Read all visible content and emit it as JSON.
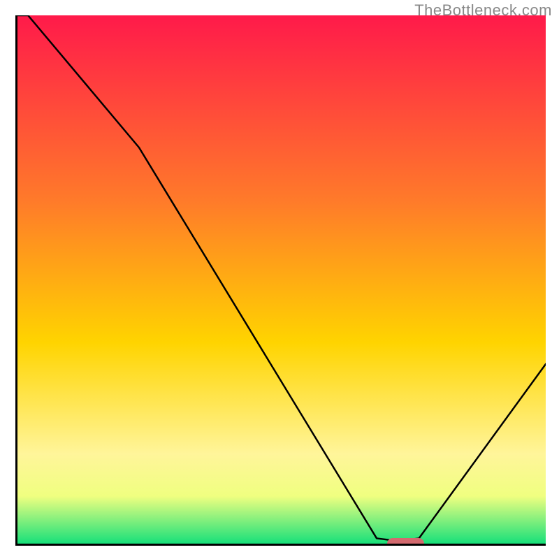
{
  "watermark": "TheBottleneck.com",
  "colors": {
    "top": "#ff1a4a",
    "mid1": "#ff7a2a",
    "mid2": "#ffd400",
    "low1": "#fff59a",
    "low2": "#f0ff80",
    "bottom": "#17e07a",
    "marker": "#d36a6f",
    "curve": "#000000",
    "axis": "#000000"
  },
  "chart_data": {
    "type": "line",
    "title": "",
    "xlabel": "",
    "ylabel": "",
    "xlim": [
      0,
      100
    ],
    "ylim": [
      0,
      100
    ],
    "x": [
      0,
      2,
      23,
      68,
      72,
      76,
      100
    ],
    "values": [
      100,
      100,
      75,
      1,
      0.5,
      1,
      34
    ],
    "annotations": [
      {
        "kind": "marker",
        "shape": "pill",
        "x_range": [
          70,
          77
        ],
        "y": 0
      }
    ],
    "background_gradient_stops": [
      {
        "offset": 0.0,
        "color": "#ff1a4a"
      },
      {
        "offset": 0.35,
        "color": "#ff7a2a"
      },
      {
        "offset": 0.62,
        "color": "#ffd400"
      },
      {
        "offset": 0.83,
        "color": "#fff59a"
      },
      {
        "offset": 0.91,
        "color": "#f0ff80"
      },
      {
        "offset": 1.0,
        "color": "#17e07a"
      }
    ]
  }
}
